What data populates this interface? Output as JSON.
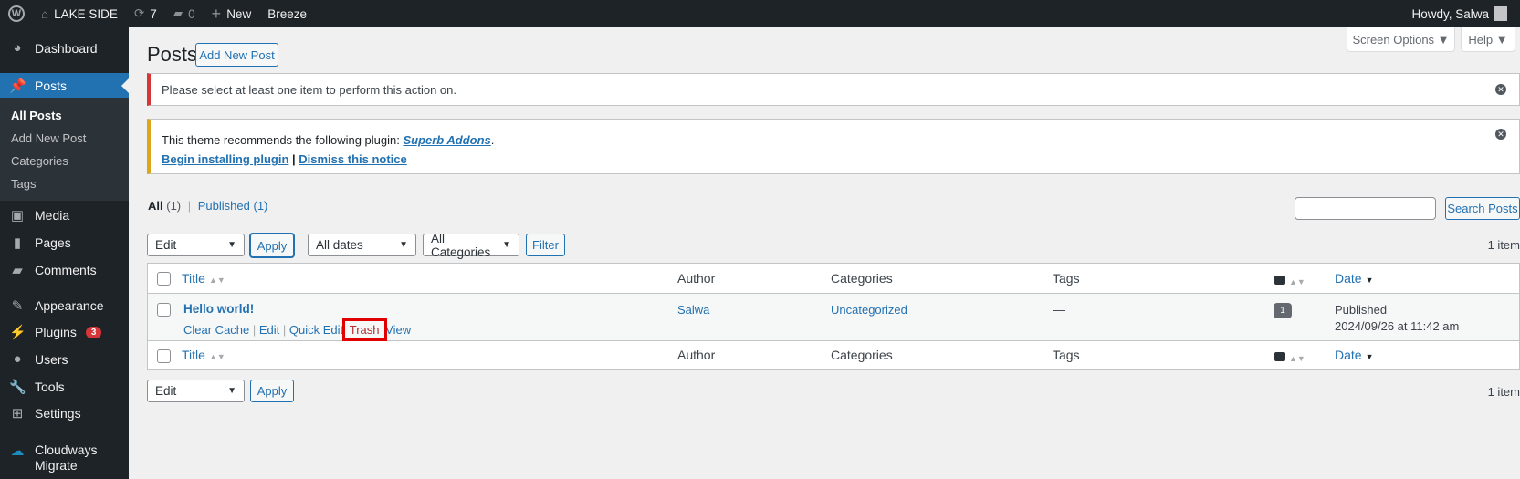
{
  "adminbar": {
    "site": "LAKE SIDE",
    "updates": "7",
    "comments": "0",
    "new": "New",
    "breeze": "Breeze",
    "howdy": "Howdy, Salwa"
  },
  "sidebar": {
    "dashboard": "Dashboard",
    "posts": "Posts",
    "sub": [
      "All Posts",
      "Add New Post",
      "Categories",
      "Tags"
    ],
    "media": "Media",
    "pages": "Pages",
    "comments": "Comments",
    "appearance": "Appearance",
    "plugins": "Plugins",
    "plugins_badge": "3",
    "users": "Users",
    "tools": "Tools",
    "settings": "Settings",
    "cloudways": "Cloudways",
    "cloudways2": "Migrate"
  },
  "header": {
    "title": "Posts",
    "add_new": "Add New Post",
    "screen_options": "Screen Options ▼",
    "help": "Help ▼"
  },
  "notices": {
    "error": "Please select at least one item to perform this action on.",
    "plugin_prefix": "This theme recommends the following plugin: ",
    "plugin_name": "Superb Addons",
    "plugin_suffix": ".",
    "begin": "Begin installing plugin",
    "sep": " | ",
    "dismiss": "Dismiss this notice"
  },
  "filters": {
    "all": "All",
    "all_count": " (1)",
    "published": "Published",
    "published_count": " (1)",
    "sep": "|",
    "search_placeholder": "",
    "search_button": "Search Posts",
    "bulk": "Edit",
    "apply": "Apply",
    "dates": "All dates",
    "categories": "All Categories",
    "filter": "Filter",
    "items": "1 item"
  },
  "table": {
    "columns": {
      "title": "Title",
      "author": "Author",
      "categories": "Categories",
      "tags": "Tags",
      "date": "Date"
    },
    "rows": [
      {
        "title": "Hello world!",
        "actions": {
          "clear_cache": "Clear Cache",
          "edit": "Edit",
          "quick_edit": "Quick Edit",
          "trash": "Trash",
          "view": "View"
        },
        "author": "Salwa",
        "category": "Uncategorized",
        "tags": "—",
        "comments": "1",
        "status": "Published",
        "date": "2024/09/26 at 11:42 am"
      }
    ]
  },
  "colors": {
    "accent": "#2271b1",
    "sidebar": "#1d2327",
    "error": "#d63638",
    "warning": "#dba617",
    "highlight": "#e00000"
  }
}
